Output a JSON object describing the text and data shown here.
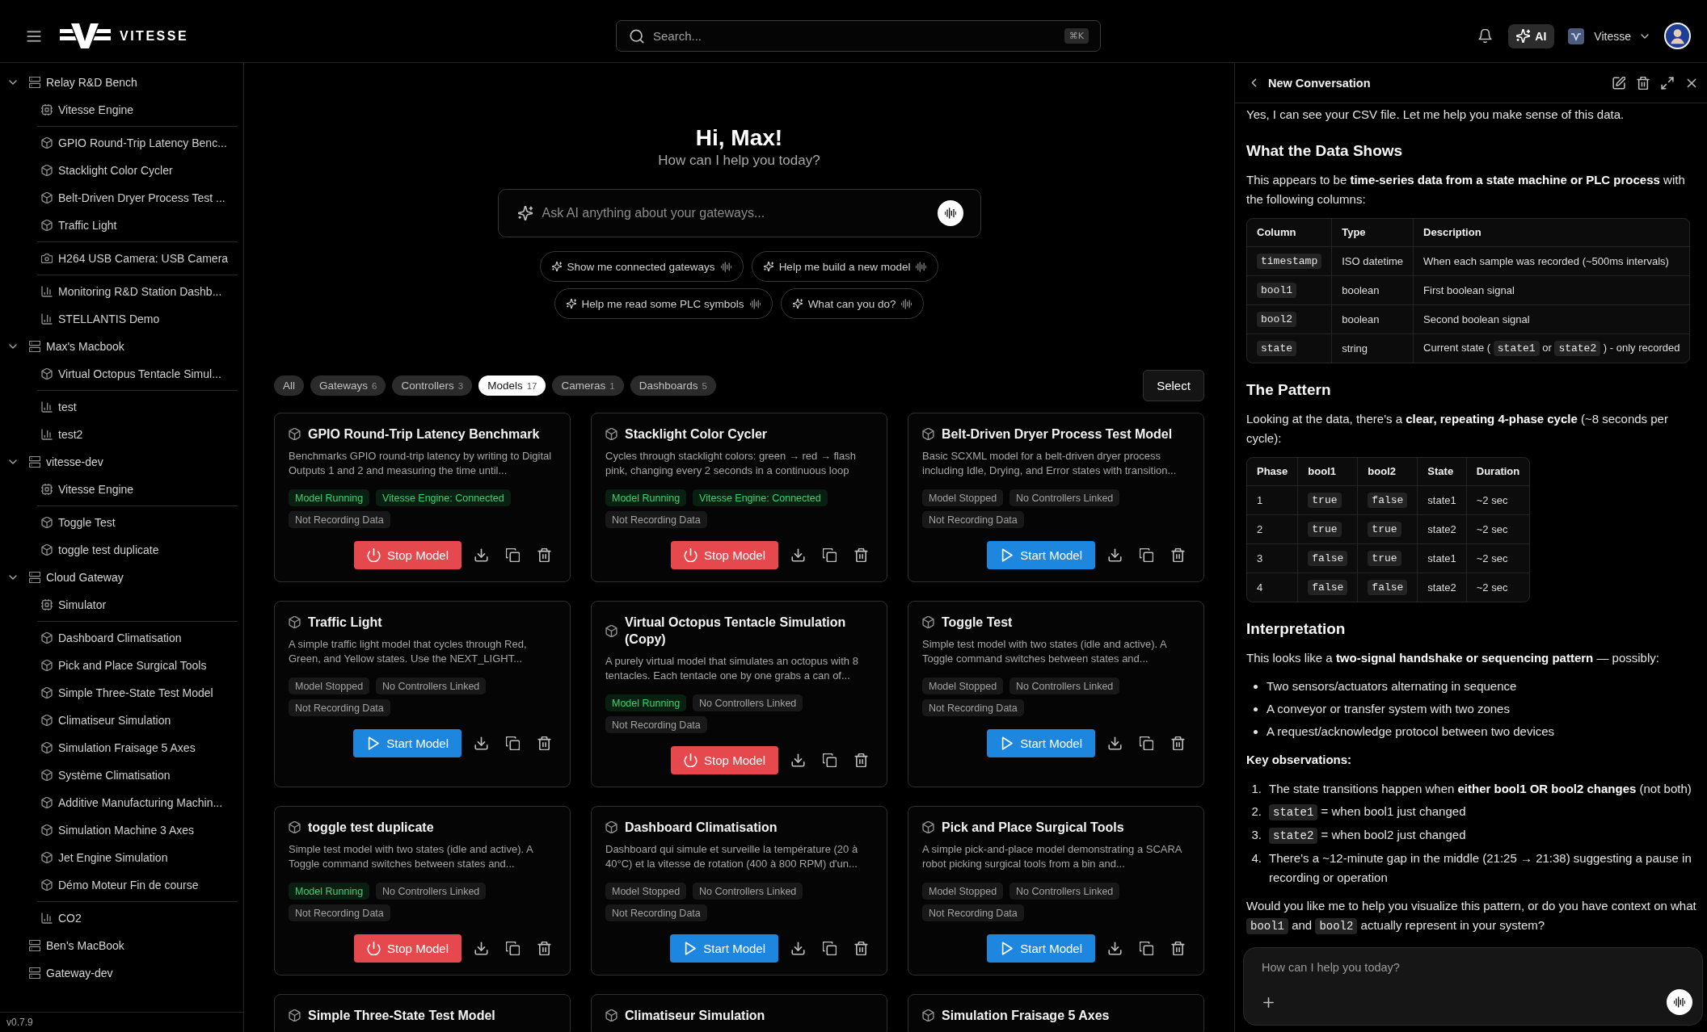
{
  "header": {
    "brand": "VITESSE",
    "search": {
      "placeholder": "Search...",
      "shortcut": "⌘K"
    },
    "ai_button": "AI",
    "workspace": "Vitesse"
  },
  "sidebar": {
    "gateways": [
      {
        "name": "Relay R&D Bench",
        "expanded": true,
        "children": [
          {
            "kind": "engine",
            "name": "Vitesse Engine"
          },
          {
            "kind": "model",
            "name": "GPIO Round-Trip Latency Benc..."
          },
          {
            "kind": "model",
            "name": "Stacklight Color Cycler"
          },
          {
            "kind": "model",
            "name": "Belt-Driven Dryer Process Test ..."
          },
          {
            "kind": "model",
            "name": "Traffic Light"
          },
          {
            "kind": "camera",
            "name": "H264 USB Camera: USB Camera"
          },
          {
            "kind": "dashboard",
            "name": "Monitoring R&D Station Dashb..."
          },
          {
            "kind": "dashboard",
            "name": "STELLANTIS Demo"
          }
        ]
      },
      {
        "name": "Max's Macbook",
        "expanded": true,
        "children": [
          {
            "kind": "model",
            "name": "Virtual Octopus Tentacle Simul..."
          },
          {
            "kind": "dashboard",
            "name": "test"
          },
          {
            "kind": "dashboard",
            "name": "test2"
          }
        ]
      },
      {
        "name": "vitesse-dev",
        "expanded": true,
        "children": [
          {
            "kind": "engine",
            "name": "Vitesse Engine"
          },
          {
            "kind": "model",
            "name": "Toggle Test"
          },
          {
            "kind": "model",
            "name": "toggle test duplicate"
          }
        ]
      },
      {
        "name": "Cloud Gateway",
        "expanded": true,
        "children": [
          {
            "kind": "engine",
            "name": "Simulator"
          },
          {
            "kind": "model",
            "name": "Dashboard Climatisation"
          },
          {
            "kind": "model",
            "name": "Pick and Place Surgical Tools"
          },
          {
            "kind": "model",
            "name": "Simple Three-State Test Model"
          },
          {
            "kind": "model",
            "name": "Climatiseur Simulation"
          },
          {
            "kind": "model",
            "name": "Simulation Fraisage 5 Axes"
          },
          {
            "kind": "model",
            "name": "Système Climatisation"
          },
          {
            "kind": "model",
            "name": "Additive Manufacturing Machin..."
          },
          {
            "kind": "model",
            "name": "Simulation Machine 3 Axes"
          },
          {
            "kind": "model",
            "name": "Jet Engine Simulation"
          },
          {
            "kind": "model",
            "name": "Démo Moteur Fin de course"
          },
          {
            "kind": "dashboard",
            "name": "CO2"
          }
        ]
      },
      {
        "name": "Ben's MacBook"
      },
      {
        "name": "Gateway-dev"
      }
    ],
    "version": "v0.7.9"
  },
  "home": {
    "greeting": "Hi, Max!",
    "subtitle": "How can I help you today?",
    "ask": {
      "placeholder": "Ask AI anything about your gateways..."
    },
    "suggestions": [
      "Show me connected gateways",
      "Help me build a new model",
      "Help me read some PLC symbols",
      "What can you do?"
    ]
  },
  "filters": [
    {
      "label": "All",
      "selected": false
    },
    {
      "label": "Gateways",
      "count": "6",
      "selected": false
    },
    {
      "label": "Controllers",
      "count": "3",
      "selected": false
    },
    {
      "label": "Models",
      "count": "17",
      "selected": true
    },
    {
      "label": "Cameras",
      "count": "1",
      "selected": false
    },
    {
      "label": "Dashboards",
      "count": "5",
      "selected": false
    }
  ],
  "select_button": "Select",
  "cards": [
    {
      "title": "GPIO Round-Trip Latency Benchmark",
      "description": "Benchmarks GPIO round-trip latency by writing to Digital Outputs 1 and 2 and measuring the time until...",
      "badges": [
        {
          "text": "Model Running",
          "color": "#3fcf72"
        },
        {
          "text": "Vitesse Engine: Connected",
          "color": "#3fcf72"
        },
        {
          "text": "Not Recording Data",
          "color": "#a2a2a2"
        }
      ],
      "button": {
        "kind": "stop",
        "label": "Stop Model"
      }
    },
    {
      "title": "Stacklight Color Cycler",
      "description": "Cycles through stacklight colors: green → red → flash pink, changing every 2 seconds in a continuous loop",
      "badges": [
        {
          "text": "Model Running",
          "color": "#3fcf72"
        },
        {
          "text": "Vitesse Engine: Connected",
          "color": "#3fcf72"
        },
        {
          "text": "Not Recording Data",
          "color": "#a2a2a2"
        }
      ],
      "button": {
        "kind": "stop",
        "label": "Stop Model"
      }
    },
    {
      "title": "Belt-Driven Dryer Process Test Model",
      "description": "Basic SCXML model for a belt-driven dryer process including Idle, Drying, and Error states with transition...",
      "badges": [
        {
          "text": "Model Stopped",
          "color": "#a2a2a2"
        },
        {
          "text": "No Controllers Linked",
          "color": "#a2a2a2"
        },
        {
          "text": "Not Recording Data",
          "color": "#a2a2a2"
        }
      ],
      "button": {
        "kind": "start",
        "label": "Start Model"
      }
    },
    {
      "title": "Traffic Light",
      "description": "A simple traffic light model that cycles through Red, Green, and Yellow states. Use the NEXT_LIGHT...",
      "badges": [
        {
          "text": "Model Stopped",
          "color": "#a2a2a2"
        },
        {
          "text": "No Controllers Linked",
          "color": "#a2a2a2"
        },
        {
          "text": "Not Recording Data",
          "color": "#a2a2a2"
        }
      ],
      "button": {
        "kind": "start",
        "label": "Start Model"
      }
    },
    {
      "title": "Virtual Octopus Tentacle Simulation (Copy)",
      "description": "A purely virtual model that simulates an octopus with 8 tentacles. Each tentacle one by one grabs a can of...",
      "badges": [
        {
          "text": "Model Running",
          "color": "#3fcf72"
        },
        {
          "text": "No Controllers Linked",
          "color": "#a2a2a2"
        },
        {
          "text": "Not Recording Data",
          "color": "#a2a2a2"
        }
      ],
      "button": {
        "kind": "stop",
        "label": "Stop Model"
      }
    },
    {
      "title": "Toggle Test",
      "description": "Simple test model with two states (idle and active). A Toggle command switches between states and...",
      "badges": [
        {
          "text": "Model Stopped",
          "color": "#a2a2a2"
        },
        {
          "text": "No Controllers Linked",
          "color": "#a2a2a2"
        },
        {
          "text": "Not Recording Data",
          "color": "#a2a2a2"
        }
      ],
      "button": {
        "kind": "start",
        "label": "Start Model"
      }
    },
    {
      "title": "toggle test duplicate",
      "description": "Simple test model with two states (idle and active). A Toggle command switches between states and...",
      "badges": [
        {
          "text": "Model Running",
          "color": "#3fcf72"
        },
        {
          "text": "No Controllers Linked",
          "color": "#a2a2a2"
        },
        {
          "text": "Not Recording Data",
          "color": "#a2a2a2"
        }
      ],
      "button": {
        "kind": "stop",
        "label": "Stop Model"
      }
    },
    {
      "title": "Dashboard Climatisation",
      "description": "Dashboard qui simule et surveille la température (20 à 40°C) et la vitesse de rotation (400 à 800 RPM) d'un...",
      "badges": [
        {
          "text": "Model Stopped",
          "color": "#a2a2a2"
        },
        {
          "text": "No Controllers Linked",
          "color": "#a2a2a2"
        },
        {
          "text": "Not Recording Data",
          "color": "#a2a2a2"
        }
      ],
      "button": {
        "kind": "start",
        "label": "Start Model"
      }
    },
    {
      "title": "Pick and Place Surgical Tools",
      "description": "A simple pick-and-place model demonstrating a SCARA robot picking surgical tools from a bin and...",
      "badges": [
        {
          "text": "Model Stopped",
          "color": "#a2a2a2"
        },
        {
          "text": "No Controllers Linked",
          "color": "#a2a2a2"
        },
        {
          "text": "Not Recording Data",
          "color": "#a2a2a2"
        }
      ],
      "button": {
        "kind": "start",
        "label": "Start Model"
      }
    },
    {
      "title": "Simple Three-State Test Model"
    },
    {
      "title": "Climatiseur Simulation"
    },
    {
      "title": "Simulation Fraisage 5 Axes"
    }
  ],
  "chat": {
    "title": "New Conversation",
    "blocks": [
      {
        "kind": "paragraph",
        "parts": [
          {
            "text": "Yes, I can see your CSV file. Let me help you make sense of this data."
          }
        ]
      },
      {
        "kind": "heading",
        "text": "What the Data Shows"
      },
      {
        "kind": "paragraph",
        "parts": [
          {
            "text": "This appears to be **time-series data from a state machine or PLC process** with the following columns:"
          }
        ]
      },
      {
        "kind": "table",
        "columns": [
          "Column",
          "Type",
          "Description"
        ],
        "rows": [
          [
            [
              {
                "code": "timestamp"
              }
            ],
            [
              {
                "text": "ISO datetime"
              }
            ],
            [
              {
                "text": "When each sample was recorded (~500ms intervals)"
              }
            ]
          ],
          [
            [
              {
                "code": "bool1"
              }
            ],
            [
              {
                "text": "boolean"
              }
            ],
            [
              {
                "text": "First boolean signal"
              }
            ]
          ],
          [
            [
              {
                "code": "bool2"
              }
            ],
            [
              {
                "text": "boolean"
              }
            ],
            [
              {
                "text": "Second boolean signal"
              }
            ]
          ],
          [
            [
              {
                "code": "state"
              }
            ],
            [
              {
                "text": "string"
              }
            ],
            [
              {
                "text": "Current state ( "
              },
              {
                "code": "state1"
              },
              {
                "text": " or "
              },
              {
                "code": "state2"
              },
              {
                "text": " ) - only recorded"
              }
            ]
          ]
        ]
      },
      {
        "kind": "heading",
        "text": "The Pattern"
      },
      {
        "kind": "paragraph",
        "parts": [
          {
            "text": "Looking at the data, there's a **clear, repeating 4-phase cycle** (~8 seconds per cycle):"
          }
        ]
      },
      {
        "kind": "table",
        "columns": [
          "Phase",
          "bool1",
          "bool2",
          "State",
          "Duration"
        ],
        "rows": [
          [
            [
              {
                "text": "1"
              }
            ],
            [
              {
                "code": "true"
              }
            ],
            [
              {
                "code": "false"
              }
            ],
            [
              {
                "text": "state1"
              }
            ],
            [
              {
                "text": "~2 sec"
              }
            ]
          ],
          [
            [
              {
                "text": "2"
              }
            ],
            [
              {
                "code": "true"
              }
            ],
            [
              {
                "code": "true"
              }
            ],
            [
              {
                "text": "state2"
              }
            ],
            [
              {
                "text": "~2 sec"
              }
            ]
          ],
          [
            [
              {
                "text": "3"
              }
            ],
            [
              {
                "code": "false"
              }
            ],
            [
              {
                "code": "true"
              }
            ],
            [
              {
                "text": "state1"
              }
            ],
            [
              {
                "text": "~2 sec"
              }
            ]
          ],
          [
            [
              {
                "text": "4"
              }
            ],
            [
              {
                "code": "false"
              }
            ],
            [
              {
                "code": "false"
              }
            ],
            [
              {
                "text": "state2"
              }
            ],
            [
              {
                "text": "~2 sec"
              }
            ]
          ]
        ]
      },
      {
        "kind": "heading",
        "text": "Interpretation"
      },
      {
        "kind": "paragraph",
        "parts": [
          {
            "text": "This looks like a **two-signal handshake or sequencing pattern** — possibly:"
          }
        ]
      },
      {
        "kind": "bullets",
        "items": [
          [
            {
              "text": "Two sensors/actuators alternating in sequence"
            }
          ],
          [
            {
              "text": "A conveyor or transfer system with two zones"
            }
          ],
          [
            {
              "text": "A request/acknowledge protocol between two devices"
            }
          ]
        ]
      },
      {
        "kind": "label",
        "text": "Key observations:"
      },
      {
        "kind": "numbered",
        "items": [
          {
            "marker": "1.",
            "parts": [
              {
                "text": "The state transitions happen when **either bool1 OR bool2 changes** (not both)"
              }
            ]
          },
          {
            "marker": "2.",
            "parts": [
              {
                "code": "state1"
              },
              {
                "text": " = when bool1 just changed"
              }
            ]
          },
          {
            "marker": "3.",
            "parts": [
              {
                "code": "state2"
              },
              {
                "text": " = when bool2 just changed"
              }
            ]
          },
          {
            "marker": "4.",
            "parts": [
              {
                "text": "There's a ~12-minute gap in the middle (21:25 → 21:38) suggesting a pause in recording or operation"
              }
            ]
          }
        ]
      },
      {
        "kind": "paragraph",
        "parts": [
          {
            "text": "Would you like me to help you visualize this pattern, or do you have context on what "
          },
          {
            "code": "bool1"
          },
          {
            "text": " and "
          },
          {
            "code": "bool2"
          },
          {
            "text": " actually represent in your system?"
          }
        ]
      }
    ],
    "input": {
      "placeholder": "How can I help you today?"
    }
  }
}
